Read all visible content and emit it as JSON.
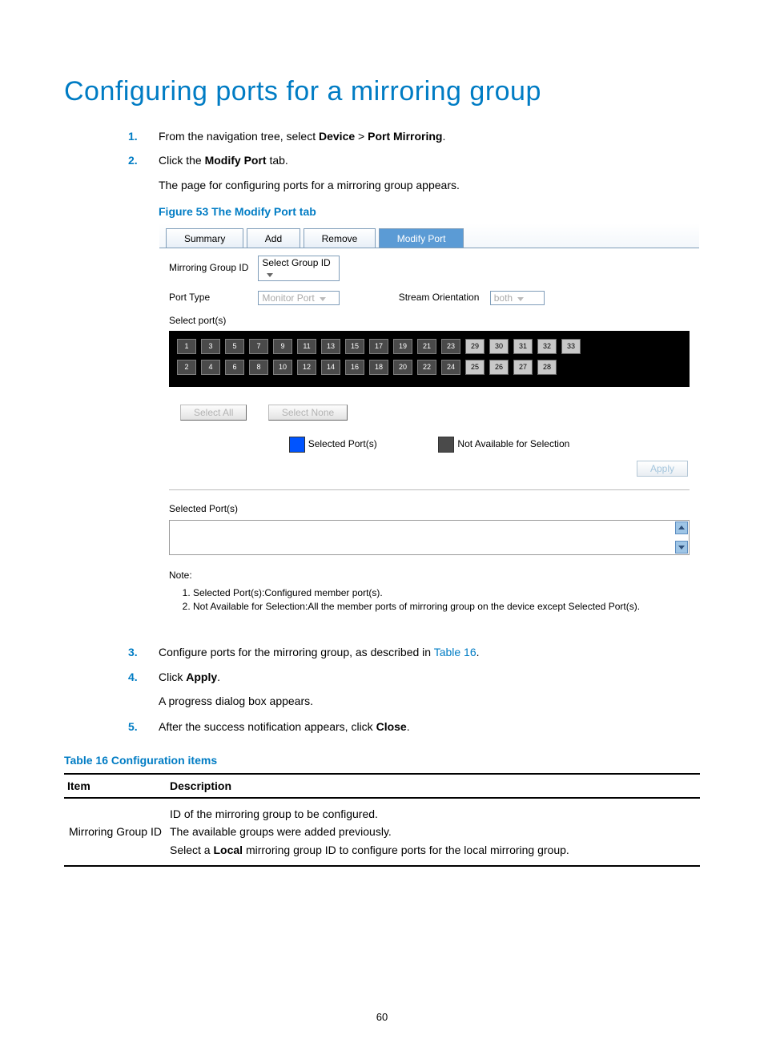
{
  "title": "Configuring ports for a mirroring group",
  "steps12": {
    "s1_pre": "From the navigation tree, select ",
    "s1_device": "Device",
    "s1_gt": " > ",
    "s1_pm": "Port Mirroring",
    "s1_post": ".",
    "s2_pre": "Click the ",
    "s2_tab": "Modify Port",
    "s2_post": " tab.",
    "s2_sub": "The page for configuring ports for a mirroring group appears."
  },
  "figure": {
    "caption": "Figure 53 The Modify Port tab"
  },
  "tabs": {
    "summary": "Summary",
    "add": "Add",
    "remove": "Remove",
    "modify": "Modify Port"
  },
  "form": {
    "mg_label": "Mirroring Group ID",
    "mg_value": "Select Group ID",
    "pt_label": "Port Type",
    "pt_value": "Monitor Port",
    "so_label": "Stream Orientation",
    "so_value": "both",
    "select_ports": "Select port(s)",
    "select_all": "Select All",
    "select_none": "Select None",
    "legend_sel": "Selected Port(s)",
    "legend_na": "Not Available for Selection",
    "apply": "Apply",
    "sel_port_label": "Selected Port(s)",
    "note_title": "Note:",
    "note1": "Selected Port(s):Configured member port(s).",
    "note2": "Not Available for Selection:All the member ports of mirroring group on the device except Selected Port(s)."
  },
  "ports_top": [
    "1",
    "3",
    "5",
    "7",
    "9",
    "11",
    "13",
    "15",
    "17",
    "19",
    "21",
    "23",
    "29",
    "30",
    "31",
    "32",
    "33"
  ],
  "ports_bottom": [
    "2",
    "4",
    "6",
    "8",
    "10",
    "12",
    "14",
    "16",
    "18",
    "20",
    "22",
    "24",
    "25",
    "26",
    "27",
    "28"
  ],
  "steps345": {
    "s3_pre": "Configure ports for the mirroring group, as described in ",
    "s3_link": "Table 16",
    "s3_post": ".",
    "s4_pre": "Click ",
    "s4_apply": "Apply",
    "s4_post": ".",
    "s4_sub": "A progress dialog box appears.",
    "s5_pre": "After the success notification appears, click ",
    "s5_close": "Close",
    "s5_post": "."
  },
  "table": {
    "caption": "Table 16 Configuration items",
    "head_item": "Item",
    "head_desc": "Description",
    "row_item": "Mirroring Group ID",
    "desc_line1": "ID of the mirroring group to be configured.",
    "desc_line2": "The available groups were added previously.",
    "desc_line3_pre": "Select a ",
    "desc_line3_local": "Local",
    "desc_line3_post": " mirroring group ID to configure ports for the local mirroring group."
  },
  "page_number": "60"
}
